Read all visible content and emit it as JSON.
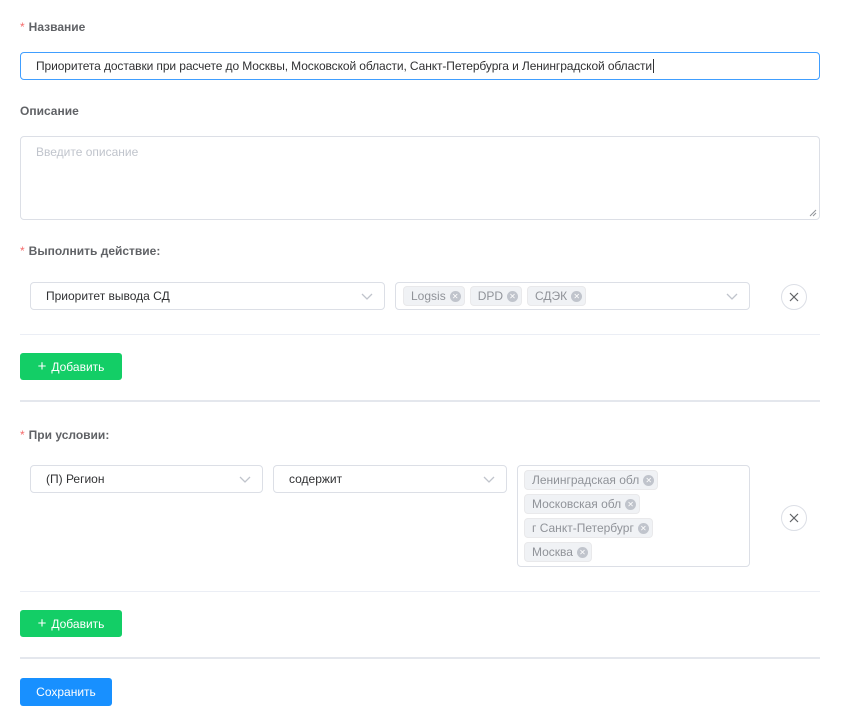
{
  "form": {
    "name": {
      "required_mark": "*",
      "label": "Название",
      "value": "Приоритета доставки при расчете до Москвы, Московской области, Санкт-Петербурга и Ленинградской области"
    },
    "description": {
      "label": "Описание",
      "placeholder": "Введите описание"
    },
    "action": {
      "required_mark": "*",
      "label": "Выполнить действие:",
      "type_select": "Приоритет вывода СД",
      "tags": [
        "Logsis",
        "DPD",
        "СДЭК"
      ],
      "add_button": "Добавить"
    },
    "condition": {
      "required_mark": "*",
      "label": "При условии:",
      "field_select": "(П) Регион",
      "operator_select": "содержит",
      "tags": [
        "Ленинградская обл",
        "Московская обл",
        "г Санкт-Петербург",
        "Москва"
      ],
      "add_button": "Добавить"
    },
    "save_button": "Сохранить"
  },
  "icons": {
    "chevron": "chevron-down-icon",
    "remove": "close-icon",
    "tag_remove": "close-small-icon",
    "add": "plus-icon"
  },
  "colors": {
    "required": "#f56c6c",
    "focus_border": "#409eff",
    "add_button": "#13ce66",
    "save_button": "#1890ff"
  }
}
